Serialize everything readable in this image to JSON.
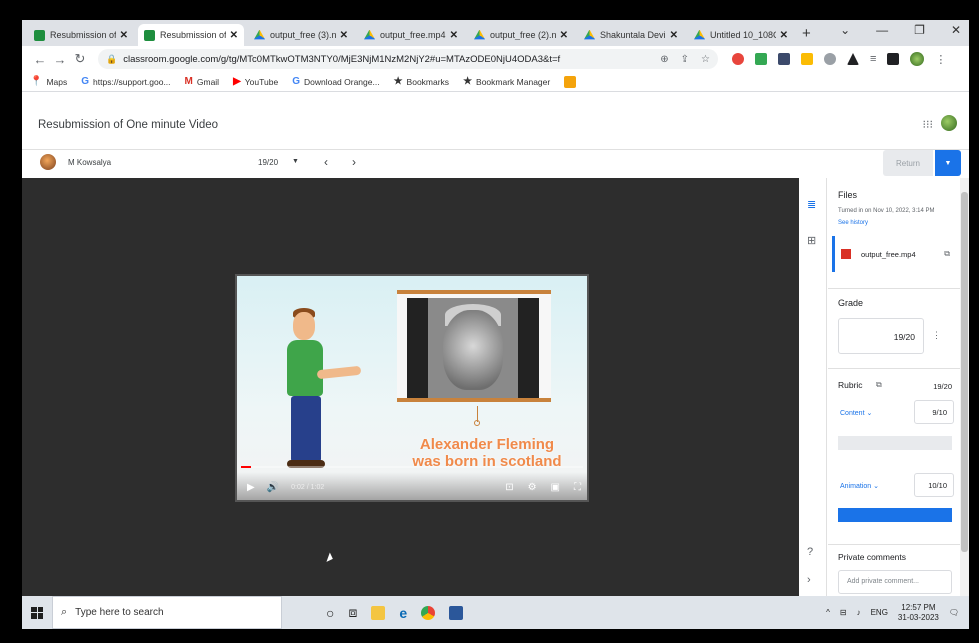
{
  "browser": {
    "tabs": [
      {
        "title": "Resubmission of",
        "icon": "classroom-icon",
        "active": false
      },
      {
        "title": "Resubmission of",
        "icon": "classroom-icon",
        "active": true
      },
      {
        "title": "output_free (3).n",
        "icon": "drive-icon",
        "active": false
      },
      {
        "title": "output_free.mp4",
        "icon": "drive-icon",
        "active": false
      },
      {
        "title": "output_free (2).n",
        "icon": "drive-icon",
        "active": false
      },
      {
        "title": "Shakuntala Devi",
        "icon": "drive-icon",
        "active": false
      },
      {
        "title": "Untitled 10_108C",
        "icon": "drive-icon",
        "active": false
      }
    ],
    "tab_close": "✕",
    "new_tab": "+",
    "window_controls": {
      "dropdown": "⌄",
      "minimize": "—",
      "restore": "❐",
      "close": "✕"
    },
    "url": "classroom.google.com/g/tg/MTc0MTkwOTM3NTY0/MjE3NjM1NzM2NjY2#u=MTAzODE0NjU4ODA3&t=f",
    "bookmarks": [
      {
        "label": "Maps",
        "icon": "maps-pin-icon"
      },
      {
        "label": "https://support.goo...",
        "icon": "google-icon"
      },
      {
        "label": "Gmail",
        "icon": "gmail-icon"
      },
      {
        "label": "YouTube",
        "icon": "youtube-icon"
      },
      {
        "label": "Download Orange...",
        "icon": "google-icon"
      },
      {
        "label": "Bookmarks",
        "icon": "star-icon"
      },
      {
        "label": "Bookmark Manager",
        "icon": "star-icon"
      }
    ]
  },
  "classroom": {
    "page_title": "Resubmission of One minute Video",
    "student_name": "M Kowsalya",
    "student_count": "19/20",
    "return_label": "Return",
    "video": {
      "caption_line1": "Alexander Fleming",
      "caption_line2": "was born in scotland",
      "time": "0:02 / 1:02",
      "progress": 0.03
    },
    "files": {
      "title": "Files",
      "turned_in": "Turned in on Nov 10, 2022, 3:14 PM",
      "see_history": "See history",
      "file_name": "output_free.mp4"
    },
    "grade": {
      "title": "Grade",
      "value": "19/20"
    },
    "rubric": {
      "title": "Rubric",
      "score": "19/20",
      "criteria": [
        {
          "name": "Content",
          "score": "9/10"
        },
        {
          "name": "Animation",
          "score": "10/10"
        }
      ]
    },
    "private_comments": {
      "title": "Private comments",
      "placeholder": "Add private comment..."
    }
  },
  "taskbar": {
    "search_placeholder": "Type here to search",
    "language": "ENG",
    "time": "12:57 PM",
    "date": "31-03-2023"
  },
  "colors": {
    "accent": "#1a73e8",
    "caption": "#f08a4b",
    "viewer_bg": "#2d2d2d"
  }
}
